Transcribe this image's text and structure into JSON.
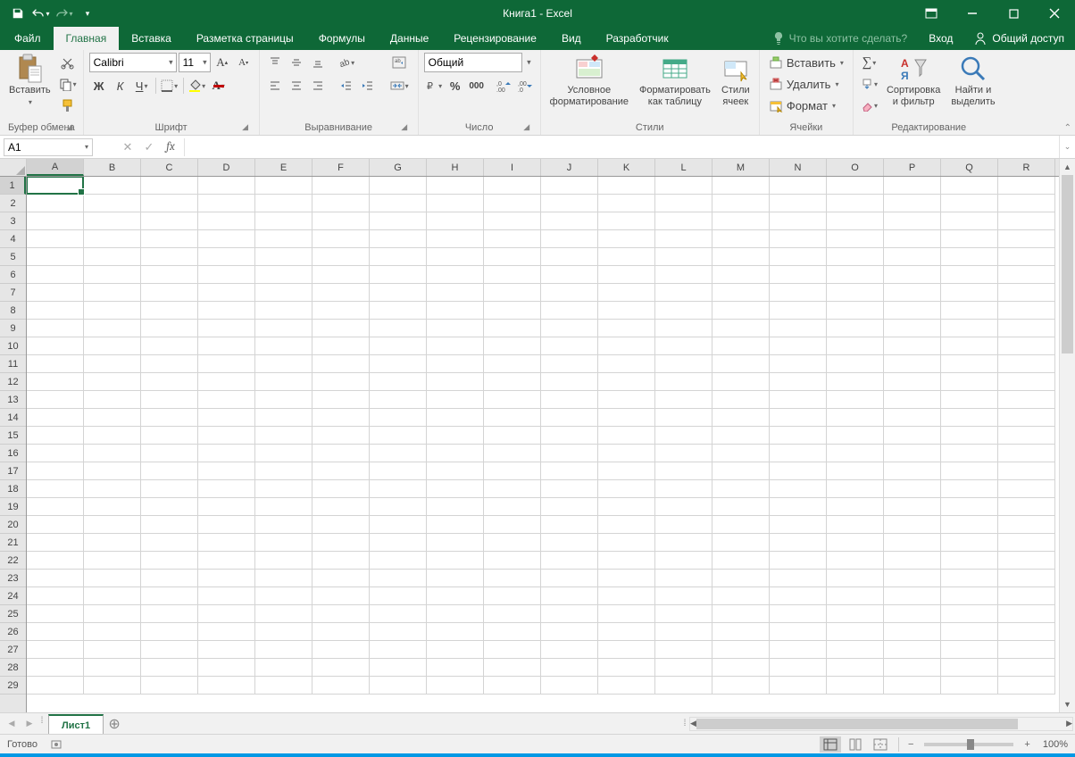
{
  "title": "Книга1 - Excel",
  "qat": {
    "save": "save-icon",
    "undo": "undo-icon",
    "redo": "redo-icon",
    "customize": "customize-icon"
  },
  "window": {
    "ribbon_opts": "ribbon-options-icon",
    "minimize": "minimize-icon",
    "maximize": "maximize-icon",
    "close": "close-icon"
  },
  "tabs": {
    "file": "Файл",
    "home": "Главная",
    "insert": "Вставка",
    "page_layout": "Разметка страницы",
    "formulas": "Формулы",
    "data": "Данные",
    "review": "Рецензирование",
    "view": "Вид",
    "developer": "Разработчик"
  },
  "tell_me": "Что вы хотите сделать?",
  "signin": "Вход",
  "share": "Общий доступ",
  "ribbon": {
    "clipboard": {
      "paste": "Вставить",
      "label": "Буфер обмена"
    },
    "font": {
      "name": "Calibri",
      "size": "11",
      "label": "Шрифт"
    },
    "align": {
      "label": "Выравнивание"
    },
    "number": {
      "format": "Общий",
      "label": "Число"
    },
    "styles": {
      "cond": "Условное\nформатирование",
      "as_table": "Форматировать\nкак таблицу",
      "cell_styles": "Стили\nячеек",
      "label": "Стили"
    },
    "cells": {
      "insert": "Вставить",
      "delete": "Удалить",
      "format": "Формат",
      "label": "Ячейки"
    },
    "editing": {
      "sort": "Сортировка\nи фильтр",
      "find": "Найти и\nвыделить",
      "label": "Редактирование"
    }
  },
  "name_box": "A1",
  "formula_value": "",
  "columns": [
    "A",
    "B",
    "C",
    "D",
    "E",
    "F",
    "G",
    "H",
    "I",
    "J",
    "K",
    "L",
    "M",
    "N",
    "O",
    "P",
    "Q",
    "R"
  ],
  "rows": [
    1,
    2,
    3,
    4,
    5,
    6,
    7,
    8,
    9,
    10,
    11,
    12,
    13,
    14,
    15,
    16,
    17,
    18,
    19,
    20,
    21,
    22,
    23,
    24,
    25,
    26,
    27,
    28,
    29
  ],
  "sheet": {
    "name": "Лист1"
  },
  "status": {
    "ready": "Готово",
    "zoom": "100%"
  }
}
